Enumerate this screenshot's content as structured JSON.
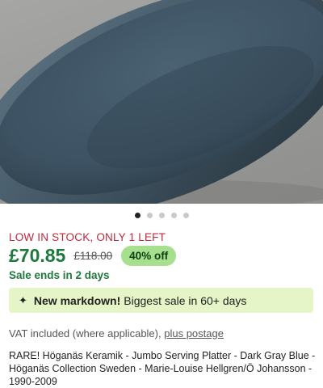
{
  "product_image": {
    "alt_icon": "serving-platter-photo",
    "carousel_count": 5,
    "carousel_active_index": 0
  },
  "listing": {
    "stock_notice": "LOW IN STOCK, ONLY 1 LEFT",
    "price": "£70.85",
    "original_price": "£118.00",
    "discount_badge": "40% off",
    "sale_ends": "Sale ends in 2 days",
    "markdown": {
      "icon": "sparkle-icon",
      "headline": "New markdown!",
      "detail": "Biggest sale in 60+ days"
    },
    "vat_text": "VAT included (where applicable),",
    "postage_link": "plus postage",
    "title": "RARE! Höganäs Keramik - Jumbo Serving Platter - Dark Gray Blue - Höganäs Collection Sweden - Marie-Louise Hellgren/Ö Johansson - 1990-2009"
  },
  "colors": {
    "stock": "#c0283c",
    "price": "#1e7a3c",
    "badge_bg": "#a6e08e",
    "markdown_bg": "#e5f5c8",
    "platter": "#3f5565"
  }
}
